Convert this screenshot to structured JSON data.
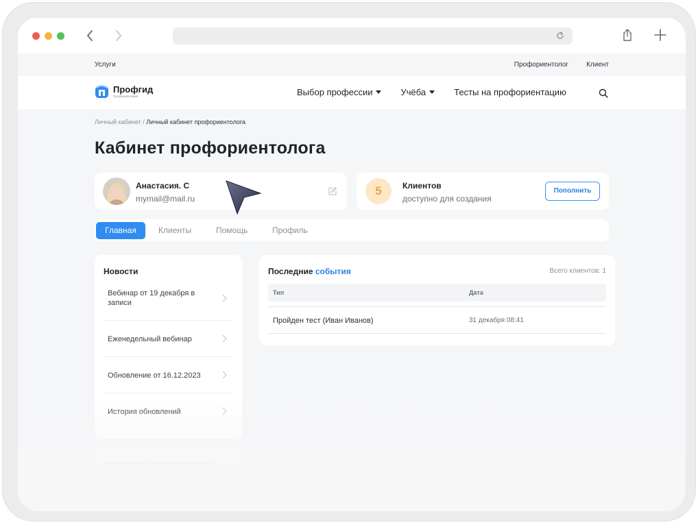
{
  "browser": {
    "traffic_lights": {
      "close_color": "#ee5b54",
      "minimize_color": "#f3b63e",
      "maximize_color": "#4fc45a"
    },
    "icons": {
      "back": "chevron-left-icon",
      "forward": "chevron-right-icon",
      "reload": "reload-icon",
      "share": "share-icon",
      "new_tab": "plus-icon"
    }
  },
  "topbar": {
    "services": "Услуги",
    "links": [
      "Профориентолог",
      "Клиент"
    ]
  },
  "header": {
    "logo_name": "Профгид",
    "logo_sub": "Профориентация",
    "menu": [
      {
        "label": "Выбор профессии",
        "dropdown": true
      },
      {
        "label": "Учёба",
        "dropdown": true
      },
      {
        "label": "Тесты на профориентацию",
        "dropdown": false
      }
    ],
    "search_icon": "search-icon"
  },
  "breadcrumb": {
    "parent": "Личный кабинет",
    "separator": " / ",
    "current": "Личный кабинет профориентолога"
  },
  "page_title": "Кабинет профориентолога",
  "profile": {
    "name": "Анастасия. С",
    "email": "mymail@mail.ru",
    "edit_icon": "edit-icon"
  },
  "clients": {
    "count": "5",
    "title": "Клиентов",
    "subtitle": "доступно для создания",
    "button": "Пополнить"
  },
  "tabs": [
    {
      "label": "Главная",
      "active": true
    },
    {
      "label": "Клиенты",
      "active": false
    },
    {
      "label": "Помощь",
      "active": false
    },
    {
      "label": "Профиль",
      "active": false
    }
  ],
  "news": {
    "title": "Новости",
    "items": [
      "Вебинар от 19 декабря в записи",
      "Еженедельный вебинар",
      "Обновление от 16.12.2023",
      "История обновлений"
    ]
  },
  "events": {
    "title_prefix": "Последние ",
    "title_accent": "события",
    "total": "Всего клиентов: 1",
    "columns": [
      "Тип",
      "Дата"
    ],
    "rows": [
      {
        "type": "Пройден тест (Иван Иванов)",
        "date": "31 декабря 08:41"
      }
    ]
  },
  "colors": {
    "accent": "#2f8cf0",
    "count_bg": "#fde7c7",
    "count_fg": "#f0a23a",
    "page_bg": "#f5f6f8"
  }
}
